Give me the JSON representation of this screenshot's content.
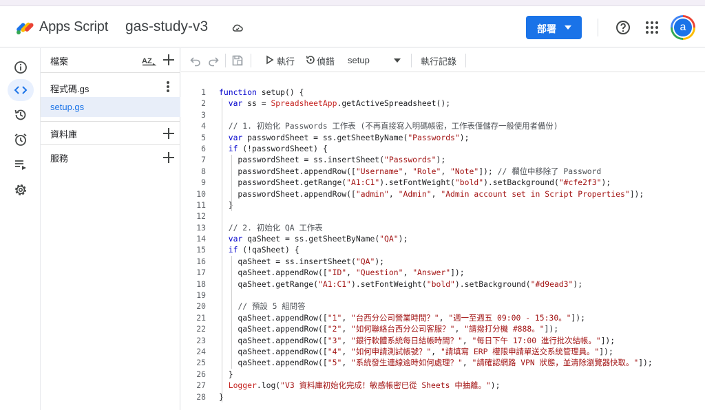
{
  "header": {
    "brand": "Apps Script",
    "project_name": "gas-study-v3",
    "deploy_label": "部署",
    "avatar_letter": "a"
  },
  "files_panel": {
    "files_title": "檔案",
    "files": [
      {
        "name": "程式碼.gs",
        "selected": false
      },
      {
        "name": "setup.gs",
        "selected": true
      }
    ],
    "libraries_title": "資料庫",
    "services_title": "服務"
  },
  "toolbar": {
    "run_label": "執行",
    "debug_label": "偵錯",
    "function_name": "setup",
    "log_label": "執行記錄"
  },
  "colors": {
    "accent": "#1a73e8",
    "keyword": "#0000cc",
    "string": "#a31515",
    "comment": "#4d5156"
  },
  "code": [
    "function setup() {",
    "  var ss = SpreadsheetApp.getActiveSpreadsheet();",
    "",
    "  // 1. 初始化 Passwords 工作表 (不再直接寫入明碼帳密，工作表僅儲存一般使用者備份)",
    "  var passwordSheet = ss.getSheetByName(\"Passwords\");",
    "  if (!passwordSheet) {",
    "    passwordSheet = ss.insertSheet(\"Passwords\");",
    "    passwordSheet.appendRow([\"Username\", \"Role\", \"Note\"]); // 欄位中移除了 Password",
    "    passwordSheet.getRange(\"A1:C1\").setFontWeight(\"bold\").setBackground(\"#cfe2f3\");",
    "    passwordSheet.appendRow([\"admin\", \"Admin\", \"Admin account set in Script Properties\"]);",
    "  }",
    "",
    "  // 2. 初始化 QA 工作表",
    "  var qaSheet = ss.getSheetByName(\"QA\");",
    "  if (!qaSheet) {",
    "    qaSheet = ss.insertSheet(\"QA\");",
    "    qaSheet.appendRow([\"ID\", \"Question\", \"Answer\"]);",
    "    qaSheet.getRange(\"A1:C1\").setFontWeight(\"bold\").setBackground(\"#d9ead3\");",
    "",
    "    // 預設 5 組問答",
    "    qaSheet.appendRow([\"1\", \"台西分公司營業時間？\", \"週一至週五 09:00 - 15:30。\"]);",
    "    qaSheet.appendRow([\"2\", \"如何聯絡台西分公司客服？\", \"請撥打分機 #888。\"]);",
    "    qaSheet.appendRow([\"3\", \"銀行軟體系統每日結帳時間？\", \"每日下午 17:00 進行批次結帳。\"]);",
    "    qaSheet.appendRow([\"4\", \"如何申請測試帳號？\", \"請填寫 ERP 權限申請單送交系統管理員。\"]);",
    "    qaSheet.appendRow([\"5\", \"系統發生連線逾時如何處理？\", \"請確認網路 VPN 狀態，並清除瀏覽器快取。\"]);",
    "  }",
    "  Logger.log(\"V3 資料庫初始化完成！敏感帳密已從 Sheets 中抽離。\");",
    "}"
  ]
}
